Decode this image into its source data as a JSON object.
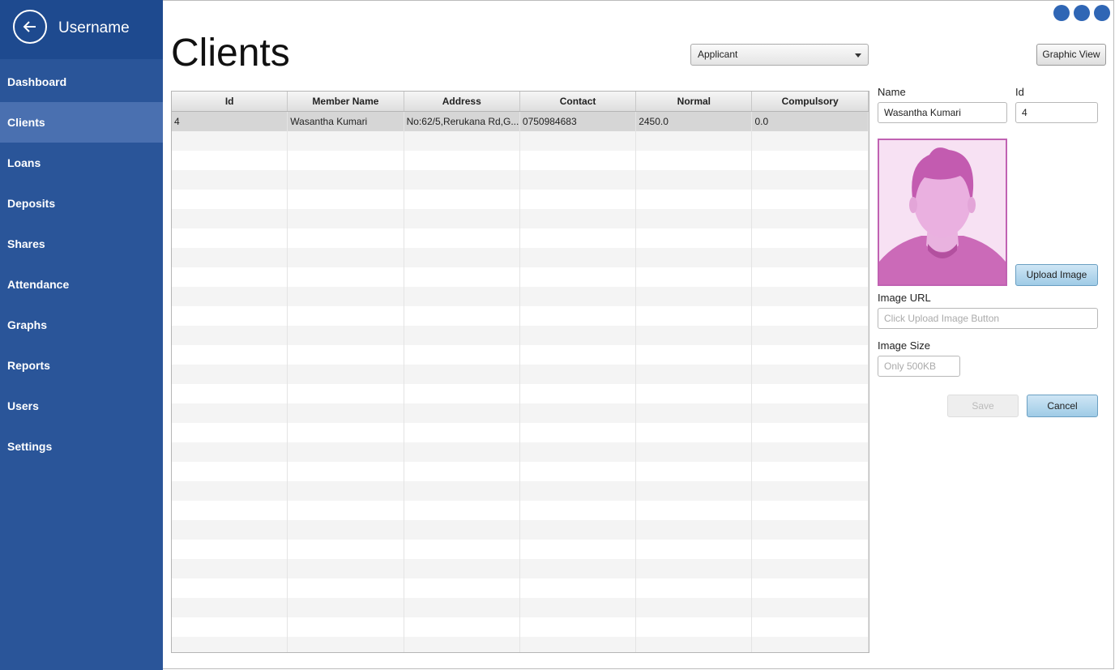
{
  "sidebar": {
    "username": "Username",
    "items": [
      {
        "label": "Dashboard",
        "name": "dashboard",
        "active": false
      },
      {
        "label": "Clients",
        "name": "clients",
        "active": true
      },
      {
        "label": "Loans",
        "name": "loans",
        "active": false
      },
      {
        "label": "Deposits",
        "name": "deposits",
        "active": false
      },
      {
        "label": "Shares",
        "name": "shares",
        "active": false
      },
      {
        "label": "Attendance",
        "name": "attendance",
        "active": false
      },
      {
        "label": "Graphs",
        "name": "graphs",
        "active": false
      },
      {
        "label": "Reports",
        "name": "reports",
        "active": false
      },
      {
        "label": "Users",
        "name": "users",
        "active": false
      },
      {
        "label": "Settings",
        "name": "settings",
        "active": false
      }
    ]
  },
  "header": {
    "title": "Clients",
    "filter_value": "Applicant",
    "graphic_view_label": "Graphic View"
  },
  "table": {
    "columns": [
      "Id",
      "Member Name",
      "Address",
      "Contact",
      "Normal",
      "Compulsory"
    ],
    "rows": [
      [
        "4",
        "Wasantha Kumari",
        "No:62/5,Rerukana Rd,G...",
        "0750984683",
        "2450.0",
        "0.0"
      ]
    ]
  },
  "form": {
    "name_label": "Name",
    "name_value": "Wasantha Kumari",
    "id_label": "Id",
    "id_value": "4",
    "upload_label": "Upload Image",
    "image_url_label": "Image URL",
    "image_url_placeholder": "Click Upload Image Button",
    "image_size_label": "Image Size",
    "image_size_placeholder": "Only 500KB",
    "save_label": "Save",
    "cancel_label": "Cancel"
  },
  "colors": {
    "sidebar": "#2a5599",
    "sidebar_header": "#1e4a8f",
    "active_item": "#4a70b0",
    "avatar_accent": "#c062b2"
  }
}
